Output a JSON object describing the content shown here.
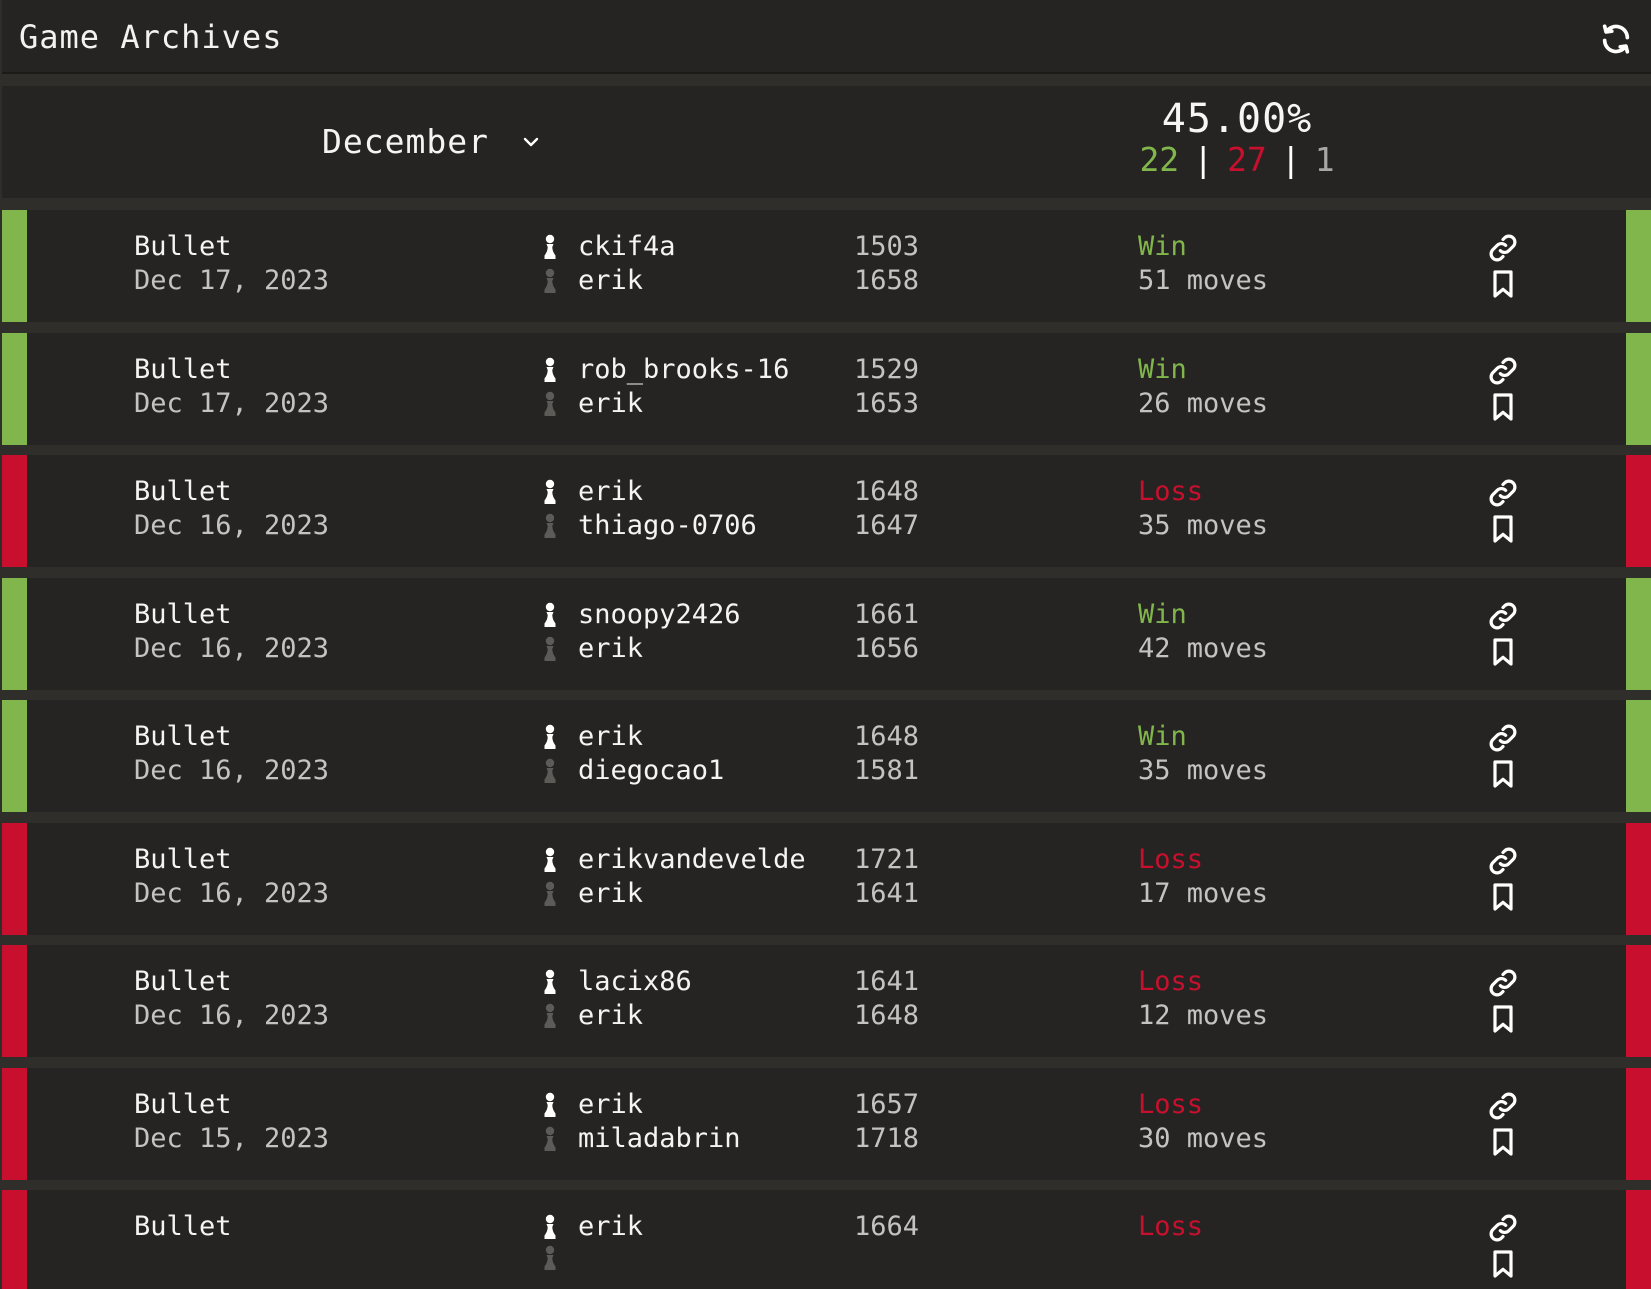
{
  "header": {
    "title": "Game Archives",
    "refresh_icon": "refresh-icon"
  },
  "summary": {
    "month": "December",
    "win_pct": "45.00%",
    "wins": "22",
    "losses": "27",
    "draws": "1",
    "separator": "|"
  },
  "colors": {
    "win": "#81b64c",
    "loss": "#c8102e",
    "background": "#302e2b",
    "panel": "#252422"
  },
  "games": [
    {
      "type": "Bullet",
      "date": "Dec 17, 2023",
      "white": "ckif4a",
      "black": "erik",
      "white_rating": "1503",
      "black_rating": "1658",
      "result": "Win",
      "moves": "51 moves",
      "outcome": "win"
    },
    {
      "type": "Bullet",
      "date": "Dec 17, 2023",
      "white": "rob_brooks-16",
      "black": "erik",
      "white_rating": "1529",
      "black_rating": "1653",
      "result": "Win",
      "moves": "26 moves",
      "outcome": "win"
    },
    {
      "type": "Bullet",
      "date": "Dec 16, 2023",
      "white": "erik",
      "black": "thiago-0706",
      "white_rating": "1648",
      "black_rating": "1647",
      "result": "Loss",
      "moves": "35 moves",
      "outcome": "loss"
    },
    {
      "type": "Bullet",
      "date": "Dec 16, 2023",
      "white": "snoopy2426",
      "black": "erik",
      "white_rating": "1661",
      "black_rating": "1656",
      "result": "Win",
      "moves": "42 moves",
      "outcome": "win"
    },
    {
      "type": "Bullet",
      "date": "Dec 16, 2023",
      "white": "erik",
      "black": "diegocao1",
      "white_rating": "1648",
      "black_rating": "1581",
      "result": "Win",
      "moves": "35 moves",
      "outcome": "win"
    },
    {
      "type": "Bullet",
      "date": "Dec 16, 2023",
      "white": "erikvandevelde",
      "black": "erik",
      "white_rating": "1721",
      "black_rating": "1641",
      "result": "Loss",
      "moves": "17 moves",
      "outcome": "loss"
    },
    {
      "type": "Bullet",
      "date": "Dec 16, 2023",
      "white": "lacix86",
      "black": "erik",
      "white_rating": "1641",
      "black_rating": "1648",
      "result": "Loss",
      "moves": "12 moves",
      "outcome": "loss"
    },
    {
      "type": "Bullet",
      "date": "Dec 15, 2023",
      "white": "erik",
      "black": "miladabrin",
      "white_rating": "1657",
      "black_rating": "1718",
      "result": "Loss",
      "moves": "30 moves",
      "outcome": "loss"
    },
    {
      "type": "Bullet",
      "date": "",
      "white": "erik",
      "black": "",
      "white_rating": "1664",
      "black_rating": "",
      "result": "Loss",
      "moves": "",
      "outcome": "loss"
    }
  ]
}
